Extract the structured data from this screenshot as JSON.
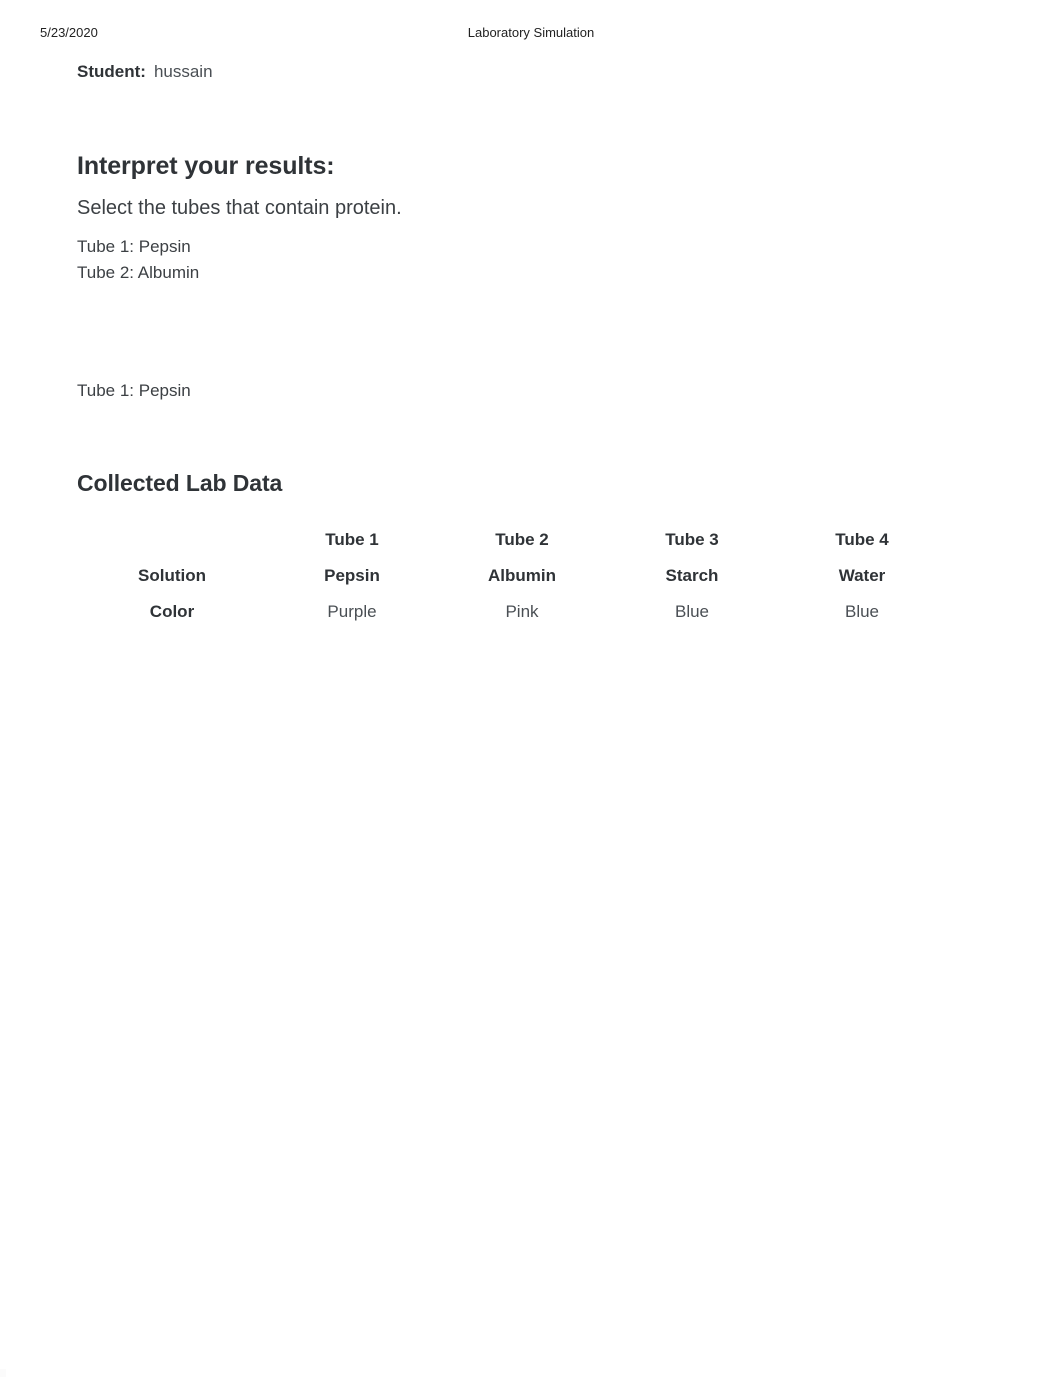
{
  "print_header": {
    "date": "5/23/2020",
    "title": "Laboratory Simulation"
  },
  "student": {
    "label": "Student:",
    "name": "hussain"
  },
  "interpret": {
    "heading": "Interpret your results:",
    "prompt": "Select the tubes that contain protein.",
    "selected": [
      "Tube 1: Pepsin",
      "Tube 2: Albumin"
    ]
  },
  "answer_block": {
    "line": "Tube 1: Pepsin"
  },
  "collected_lab_data": {
    "heading": "Collected Lab Data",
    "corner_label": "",
    "columns": [
      "Tube 1",
      "Tube 2",
      "Tube 3",
      "Tube 4"
    ],
    "rows": [
      {
        "label": "Solution",
        "bold": true,
        "values": [
          "Pepsin",
          "Albumin",
          "Starch",
          "Water"
        ]
      },
      {
        "label": "Color",
        "bold": false,
        "values": [
          "Purple",
          "Pink",
          "Blue",
          "Blue"
        ]
      }
    ]
  }
}
